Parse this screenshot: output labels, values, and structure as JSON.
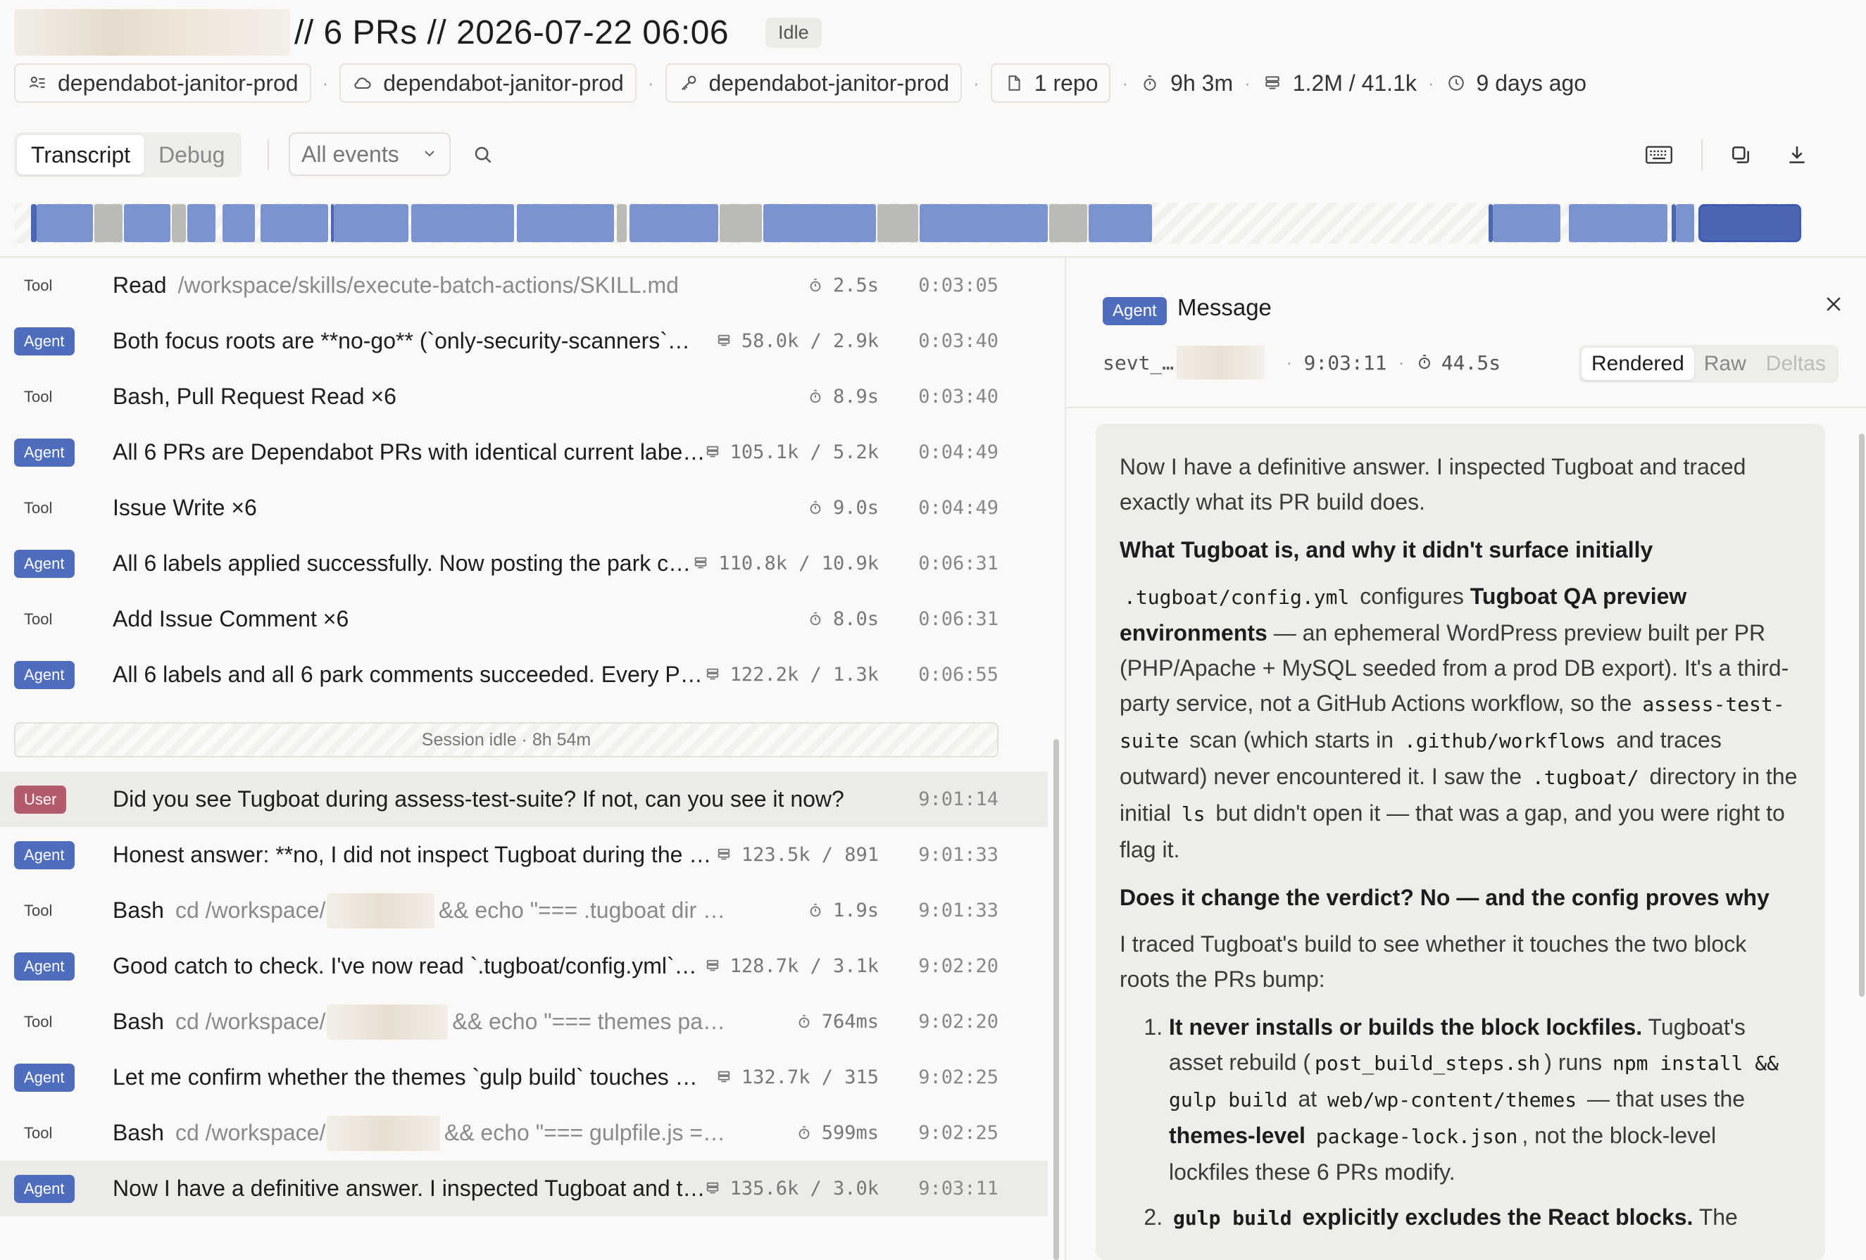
{
  "header": {
    "title": "// 6 PRs // 2026-07-22 06:06",
    "status": "Idle",
    "chip_env": "dependabot-janitor-prod",
    "chip_cloud": "dependabot-janitor-prod",
    "chip_key": "dependabot-janitor-prod",
    "chip_repo": "1 repo",
    "duration": "9h 3m",
    "tokens": "1.2M / 41.1k",
    "age": "9 days ago"
  },
  "toolbar": {
    "tab_transcript": "Transcript",
    "tab_debug": "Debug",
    "filter_label": "All events"
  },
  "rows": [
    {
      "kind": "Tool",
      "text": "Read",
      "path": "/workspace/skills/execute-batch-actions/SKILL.md",
      "stat": "2.5s",
      "time": "0:03:05"
    },
    {
      "kind": "Agent",
      "text": "Both focus roots are **no-go** (`only-security-scanners`…",
      "stat": "58.0k / 2.9k",
      "time": "0:03:40"
    },
    {
      "kind": "Tool",
      "text": "Bash, Pull Request Read ×6",
      "stat": "8.9s",
      "time": "0:03:40"
    },
    {
      "kind": "Agent",
      "text": "All 6 PRs are Dependabot PRs with identical current labe…",
      "stat": "105.1k / 5.2k",
      "time": "0:04:49"
    },
    {
      "kind": "Tool",
      "text": "Issue Write ×6",
      "stat": "9.0s",
      "time": "0:04:49"
    },
    {
      "kind": "Agent",
      "text": "All 6 labels applied successfully. Now posting the park c…",
      "stat": "110.8k / 10.9k",
      "time": "0:06:31"
    },
    {
      "kind": "Tool",
      "text": "Add Issue Comment ×6",
      "stat": "8.0s",
      "time": "0:06:31"
    },
    {
      "kind": "Agent",
      "text": "All 6 labels and all 6 park comments succeeded. Every P…",
      "stat": "122.2k / 1.3k",
      "time": "0:06:55"
    },
    {
      "kind": "User",
      "text": "Did you see Tugboat during assess-test-suite? If not, can you see it now?",
      "stat": "",
      "time": "9:01:14"
    },
    {
      "kind": "Agent",
      "text": "Honest answer: **no, I did not inspect Tugboat during the …",
      "stat": "123.5k / 891",
      "time": "9:01:33"
    },
    {
      "kind": "Tool",
      "text": "Bash",
      "path": "cd /workspace/",
      "path2": "&& echo \"=== .tugboat dir …",
      "stat": "1.9s",
      "time": "9:01:33"
    },
    {
      "kind": "Agent",
      "text": "Good catch to check. I've now read `.tugboat/config.yml`…",
      "stat": "128.7k / 3.1k",
      "time": "9:02:20"
    },
    {
      "kind": "Tool",
      "text": "Bash",
      "path": "cd /workspace/",
      "path2": "&& echo \"=== themes pa…",
      "stat": "764ms",
      "time": "9:02:20"
    },
    {
      "kind": "Agent",
      "text": "Let me confirm whether the themes `gulp build` touches …",
      "stat": "132.7k / 315",
      "time": "9:02:25"
    },
    {
      "kind": "Tool",
      "text": "Bash",
      "path": "cd /workspace/",
      "path2": "&& echo \"=== gulpfile.js =…",
      "stat": "599ms",
      "time": "9:02:25"
    },
    {
      "kind": "Agent",
      "text": "Now I have a definitive answer. I inspected Tugboat and t…",
      "stat": "135.6k / 3.0k",
      "time": "9:03:11"
    }
  ],
  "idle_separator": "Session idle · 8h 54m",
  "panel": {
    "badge": "Agent",
    "title": "Message",
    "id": "sevt_…",
    "time": "9:03:11",
    "duration": "44.5s",
    "view_rendered": "Rendered",
    "view_raw": "Raw",
    "view_deltas": "Deltas",
    "p1": "Now I have a definitive answer. I inspected Tugboat and traced exactly what its PR build does.",
    "h1": "What Tugboat is, and why it didn't surface initially",
    "p2_code1": ".tugboat/config.yml",
    "p2_a": " configures ",
    "p2_b": "Tugboat QA preview environments",
    "p2_c": " — an ephemeral WordPress preview built per PR (PHP/Apache + MySQL seeded from a prod DB export). It's a third-party service, not a GitHub Actions workflow, so the ",
    "p2_code2": "assess-test-suite",
    "p2_d": " scan (which starts in ",
    "p2_code3": ".github/workflows",
    "p2_e": " and traces outward) never encountered it. I saw the ",
    "p2_code4": ".tugboat/",
    "p2_f": " directory in the initial ",
    "p2_code5": "ls",
    "p2_g": " but didn't open it — that was a gap, and you were right to flag it.",
    "h2": "Does it change the verdict? No — and the config proves why",
    "p3": "I traced Tugboat's build to see whether it touches the two block roots the PRs bump:",
    "li1_b": "It never installs or builds the block lockfiles.",
    "li1_a": " Tugboat's asset rebuild (",
    "li1_code1": "post_build_steps.sh",
    "li1_c": ") runs ",
    "li1_code2": "npm install && gulp build",
    "li1_d": " at ",
    "li1_code3": "web/wp-content/themes",
    "li1_e": " — that uses the ",
    "li1_b2": "themes-level",
    "li1_code4": "package-lock.json",
    "li1_f": ", not the block-level lockfiles these 6 PRs modify.",
    "li2_code": "gulp build",
    "li2_b": " explicitly excludes the React blocks.",
    "li2_a": " The"
  },
  "colors": {
    "agent_badge": "#4f6dbd",
    "user_badge": "#b35a6b",
    "timeline_agent": "#7b93cf",
    "timeline_idle": "#bcbab5"
  }
}
